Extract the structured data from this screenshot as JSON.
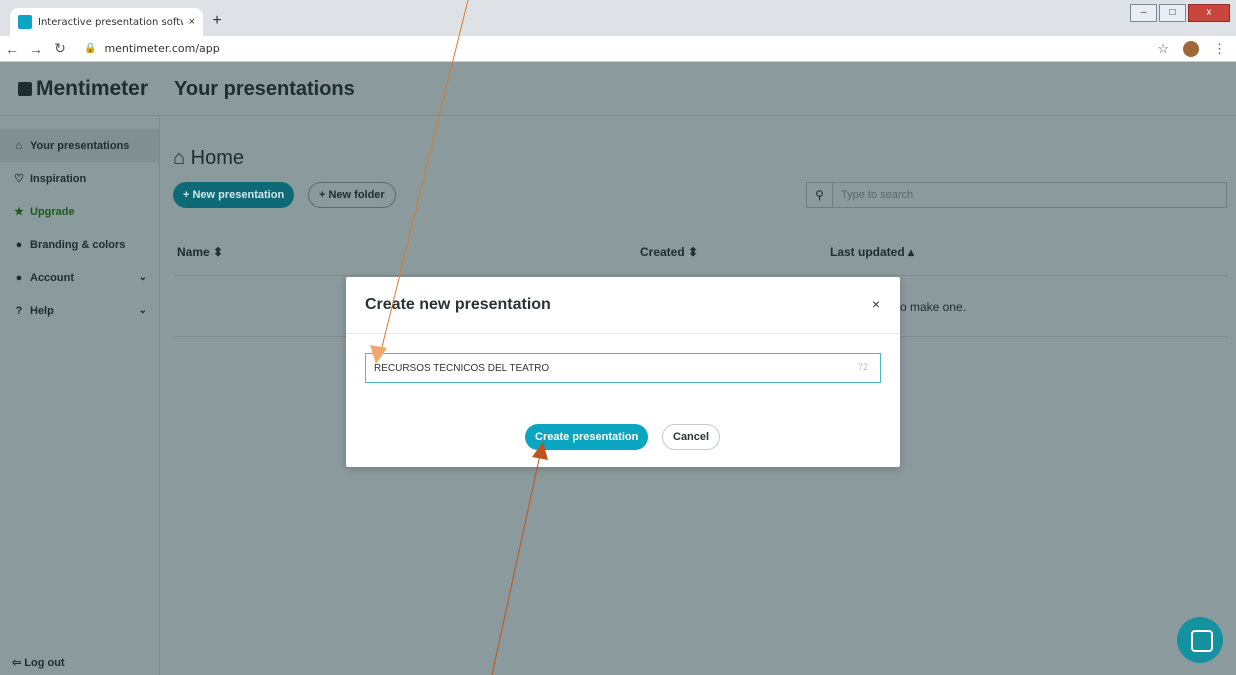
{
  "browser": {
    "tab_title": "Interactive presentation software",
    "tab_close": "×",
    "new_tab": "+",
    "url": "mentimeter.com/app",
    "win_min": "–",
    "win_max": "□",
    "win_close": "x"
  },
  "app": {
    "logo": "Mentimeter",
    "page_title": "Your presentations"
  },
  "sidebar": {
    "items": [
      {
        "label": "Your presentations"
      },
      {
        "label": "Inspiration"
      },
      {
        "label": "Upgrade"
      },
      {
        "label": "Branding & colors"
      },
      {
        "label": "Account"
      },
      {
        "label": "Help"
      }
    ],
    "logout": "Log out"
  },
  "main": {
    "home_title": "Home",
    "new_presentation": "+ New presentation",
    "new_folder": "+ New folder",
    "search_placeholder": "Type to search",
    "columns": {
      "name": "Name ⬍",
      "created": "Created ⬍",
      "last_updated": "Last updated ▴"
    },
    "empty_fragment": "o make one."
  },
  "modal": {
    "title": "Create new presentation",
    "close": "×",
    "input_value": "RECURSOS TÉCNICOS DEL TEATRO",
    "char_count": "72",
    "create_button": "Create presentation",
    "cancel_button": "Cancel"
  },
  "colors": {
    "accent": "#0aa5c0",
    "annotation_arrow": "#e07a2a"
  }
}
